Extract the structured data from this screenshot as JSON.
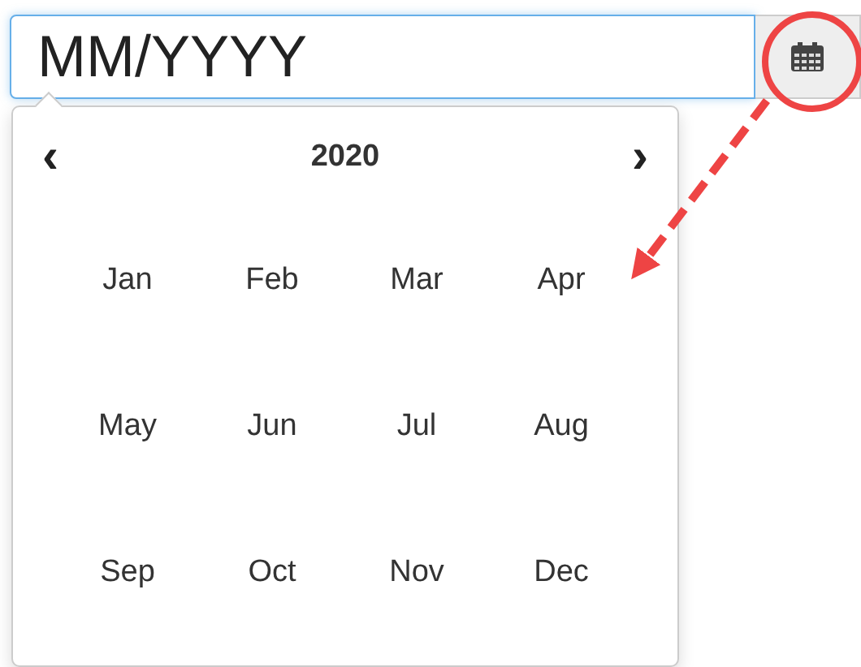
{
  "date_field": {
    "placeholder": "MM/YYYY"
  },
  "picker": {
    "prev": "‹",
    "year": "2020",
    "next": "›",
    "months": [
      "Jan",
      "Feb",
      "Mar",
      "Apr",
      "May",
      "Jun",
      "Jul",
      "Aug",
      "Sep",
      "Oct",
      "Nov",
      "Dec"
    ]
  }
}
